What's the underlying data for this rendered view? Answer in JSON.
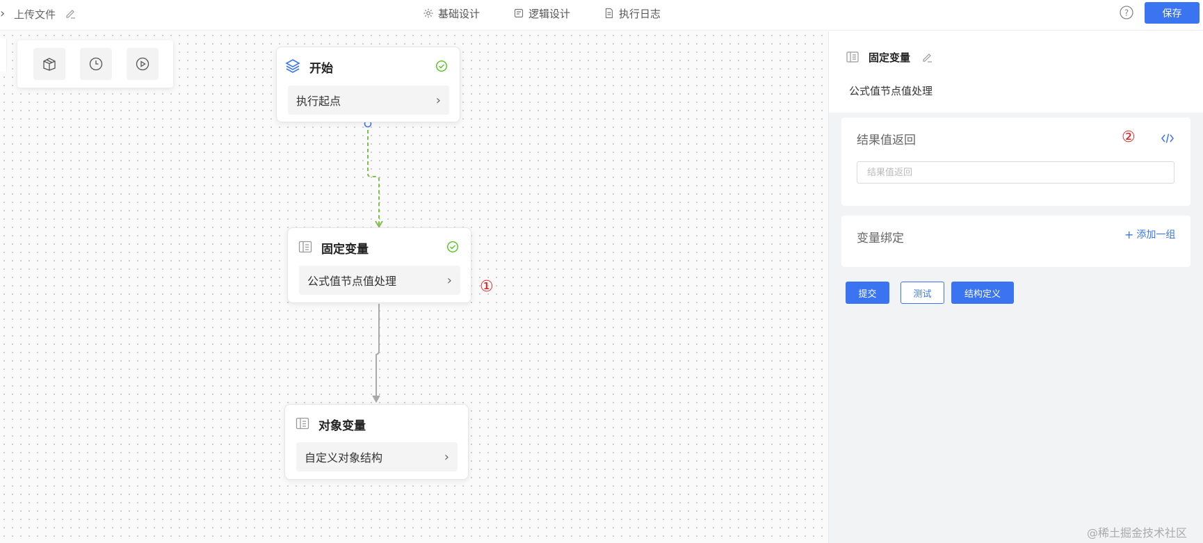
{
  "header": {
    "file_name": "上传文件",
    "tabs": [
      {
        "label": "基础设计",
        "icon": "gear-icon"
      },
      {
        "label": "逻辑设计",
        "icon": "logic-icon"
      },
      {
        "label": "执行日志",
        "icon": "document-icon"
      }
    ],
    "save_label": "保存"
  },
  "toolbox": {
    "tools": [
      "box-icon",
      "clock-icon",
      "play-icon"
    ]
  },
  "nodes": {
    "start": {
      "title": "开始",
      "row": "执行起点",
      "status": "done"
    },
    "fixed_var": {
      "title": "固定变量",
      "row": "公式值节点值处理",
      "status": "done"
    },
    "object_var": {
      "title": "对象变量",
      "row": "自定义对象结构"
    }
  },
  "annotations": {
    "one": "①",
    "two": "②"
  },
  "panel": {
    "title": "固定变量",
    "subtitle": "公式值节点值处理",
    "result_section": {
      "title": "结果值返回",
      "input_placeholder": "结果值返回",
      "input_value": ""
    },
    "binding_section": {
      "title": "变量绑定",
      "add_label": "添加一组"
    },
    "buttons": {
      "submit": "提交",
      "test": "测试",
      "structure": "结构定义"
    }
  },
  "watermark": "@稀土掘金技术社区",
  "colors": {
    "accent": "#3a74f0",
    "success": "#52c41a",
    "annotation": "#e02020",
    "edge_active": "#7cc04a",
    "edge_default": "#a9a9a9"
  }
}
